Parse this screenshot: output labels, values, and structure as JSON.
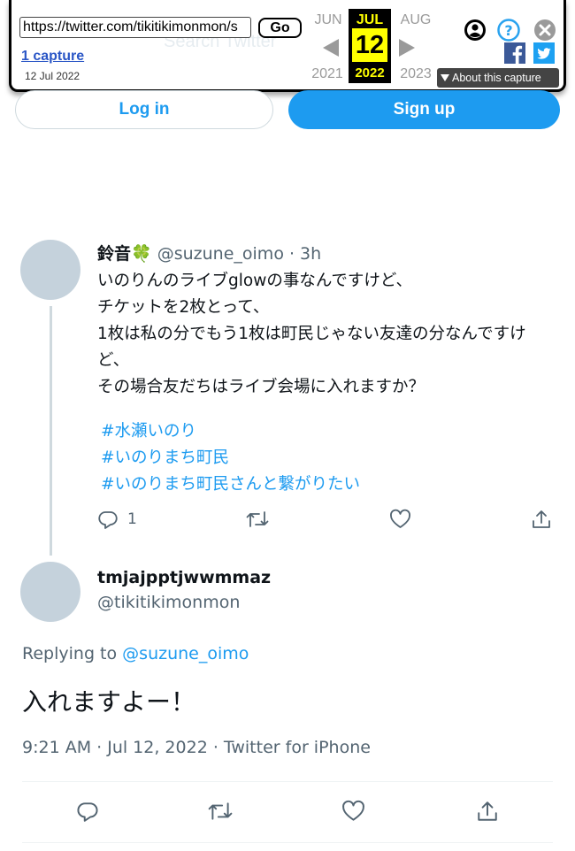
{
  "wayback": {
    "url": "https://twitter.com/tikitikimonmon/s",
    "go_label": "Go",
    "captures_label": "1 capture",
    "capture_date": "12 Jul 2022",
    "prev_month": "JUN",
    "cur_month": "JUL",
    "next_month": "AUG",
    "cur_day": "12",
    "prev_year": "2021",
    "cur_year": "2022",
    "next_year": "2023",
    "about_label": "About this capture",
    "background_search_placeholder": "Search Twitter"
  },
  "auth": {
    "login_label": "Log in",
    "signup_label": "Sign up"
  },
  "tweet1": {
    "name": "鈴音🍀",
    "handle_time": "@suzune_oimo · 3h",
    "lines": [
      "いのりんのライブglowの事なんですけど、",
      "チケットを2枚とって、",
      "1枚は私の分でもう1枚は町民じゃない友達の分なんですけ",
      "ど、",
      "その場合友だちはライブ会場に入れますか？"
    ],
    "hashtags": [
      "#水瀬いのり",
      "#いのりまち町民",
      "#いのりまち町民さんと繋がりたい"
    ],
    "reply_count": "1"
  },
  "tweet2": {
    "name": "tmjajpptjwwmmaz",
    "handle": "@tikitikimonmon",
    "replying_prefix": "Replying to",
    "replying_to": "@suzune_oimo",
    "text": "入れますよー！",
    "meta": "9:21 AM · Jul 12, 2022 · Twitter for iPhone"
  },
  "colors": {
    "accent": "#1d9bf0",
    "wayback_highlight": "#ffff00"
  }
}
